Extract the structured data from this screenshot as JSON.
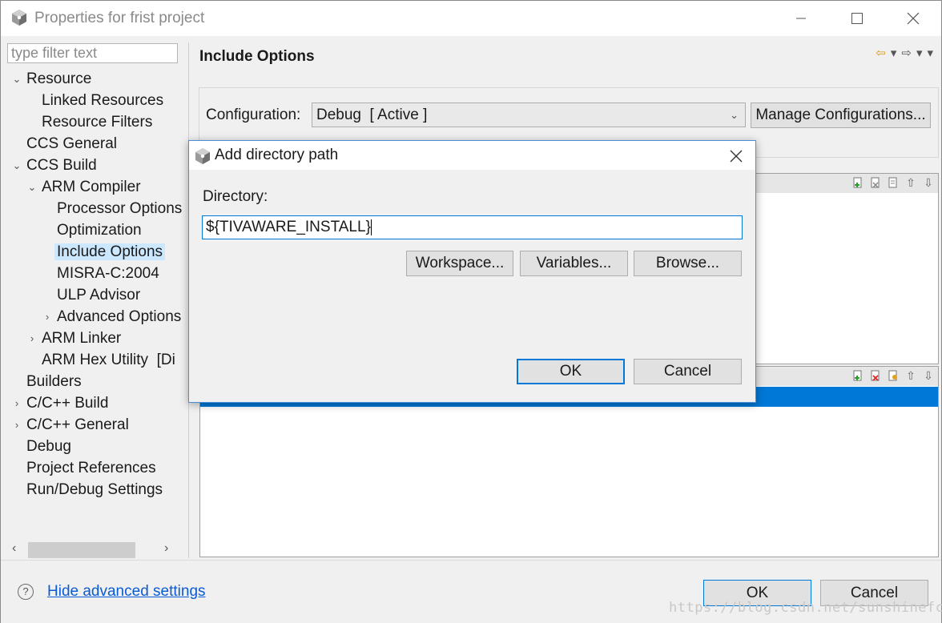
{
  "window": {
    "title": "Properties for frist project"
  },
  "filter": {
    "placeholder": "type filter text"
  },
  "tree": {
    "items": [
      {
        "label": "Resource",
        "chevron": "down"
      },
      {
        "label": "Linked Resources"
      },
      {
        "label": "Resource Filters"
      },
      {
        "label": "CCS General"
      },
      {
        "label": "CCS Build",
        "chevron": "down"
      },
      {
        "label": "ARM Compiler",
        "chevron": "down"
      },
      {
        "label": "Processor Options"
      },
      {
        "label": "Optimization"
      },
      {
        "label": "Include Options",
        "selected": true
      },
      {
        "label": "MISRA-C:2004"
      },
      {
        "label": "ULP Advisor"
      },
      {
        "label": "Advanced Options",
        "chevron": "right"
      },
      {
        "label": "ARM Linker",
        "chevron": "right"
      },
      {
        "label": "ARM Hex Utility  [Di"
      },
      {
        "label": "Builders"
      },
      {
        "label": "C/C++ Build",
        "chevron": "right"
      },
      {
        "label": "C/C++ General",
        "chevron": "right"
      },
      {
        "label": "Debug"
      },
      {
        "label": "Project References"
      },
      {
        "label": "Run/Debug Settings"
      }
    ]
  },
  "page": {
    "title": "Include Options",
    "configuration_label": "Configuration:",
    "configuration_value": "Debug  [ Active ]",
    "manage_button": "Manage Configurations..."
  },
  "dialog": {
    "title": "Add directory path",
    "directory_label": "Directory:",
    "directory_value": "${TIVAWARE_INSTALL}",
    "workspace_button": "Workspace...",
    "variables_button": "Variables...",
    "browse_button": "Browse...",
    "ok_button": "OK",
    "cancel_button": "Cancel"
  },
  "bottom": {
    "help_link": "Hide advanced settings",
    "ok_button": "OK",
    "cancel_button": "Cancel"
  },
  "watermark": "https://blog.csdn.net/sunshinefcx",
  "colors": {
    "selection": "#0078d7",
    "link": "#0a5bd3",
    "tree_selected": "#cce8ff"
  }
}
